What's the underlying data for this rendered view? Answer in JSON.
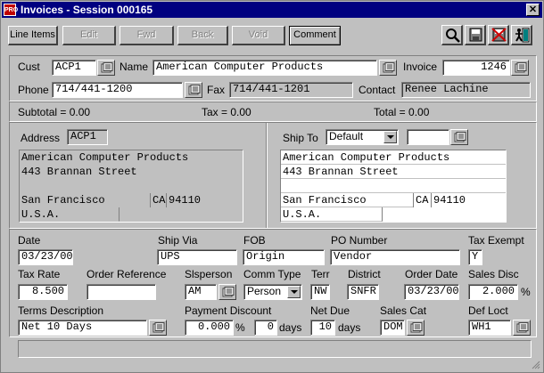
{
  "window": {
    "title": "Invoices - Session 000165",
    "app_badge": "PRO"
  },
  "toolbar": {
    "line_items": "Line Items",
    "edit": "Edit",
    "fwd": "Fwd",
    "back": "Back",
    "void": "Void",
    "comment": "Comment"
  },
  "header": {
    "cust_label": "Cust",
    "cust": "ACP1",
    "name_label": "Name",
    "name": "American Computer Products",
    "invoice_label": "Invoice",
    "invoice": "1246",
    "phone_label": "Phone",
    "phone": "714/441-1200",
    "fax_label": "Fax",
    "fax": "714/441-1201",
    "contact_label": "Contact",
    "contact": "Renee Lachine"
  },
  "totals": {
    "subtotal": "Subtotal =  0.00",
    "tax": "Tax =  0.00",
    "total": "Total =  0.00"
  },
  "address": {
    "label": "Address",
    "code": "ACP1",
    "line1": "American Computer Products",
    "line2": "443 Brannan Street",
    "line3": "",
    "city": "San Francisco",
    "state": "CA",
    "zip": "94110",
    "country": "U.S.A."
  },
  "shipto": {
    "label": "Ship To",
    "selected": "Default",
    "code": "",
    "line1": "American Computer Products",
    "line2": "443 Brannan Street",
    "line3": "",
    "city": "San Francisco",
    "state": "CA",
    "zip": "94110",
    "country": "U.S.A."
  },
  "details": {
    "date_label": "Date",
    "date": "03/23/00",
    "shipvia_label": "Ship Via",
    "shipvia": "UPS",
    "fob_label": "FOB",
    "fob": "Origin",
    "po_label": "PO Number",
    "po": "Vendor",
    "taxexempt_label": "Tax Exempt",
    "taxexempt": "Y",
    "taxrate_label": "Tax Rate",
    "taxrate": "8.500",
    "orderref_label": "Order Reference",
    "orderref": "",
    "slsperson_label": "Slsperson",
    "slsperson": "AM",
    "commtype_label": "Comm Type",
    "commtype": "Person",
    "terr_label": "Terr",
    "terr": "NW",
    "district_label": "District",
    "district": "SNFR",
    "orderdate_label": "Order Date",
    "orderdate": "03/23/00",
    "salesdisc_label": "Sales Disc",
    "salesdisc": "2.000",
    "salesdisc_unit": "%",
    "terms_label": "Terms Description",
    "terms": "Net 10 Days",
    "paydisc_label": "Payment Discount",
    "paydisc": "0.000",
    "paydisc_unit": "%",
    "paydays": "0",
    "paydays_unit": "days",
    "netdue_label": "Net Due",
    "netdue": "10",
    "netdue_unit": "days",
    "salescat_label": "Sales Cat",
    "salescat": "DOM",
    "defloct_label": "Def Loct",
    "defloct": "WH1"
  },
  "status": {
    "text": ""
  }
}
